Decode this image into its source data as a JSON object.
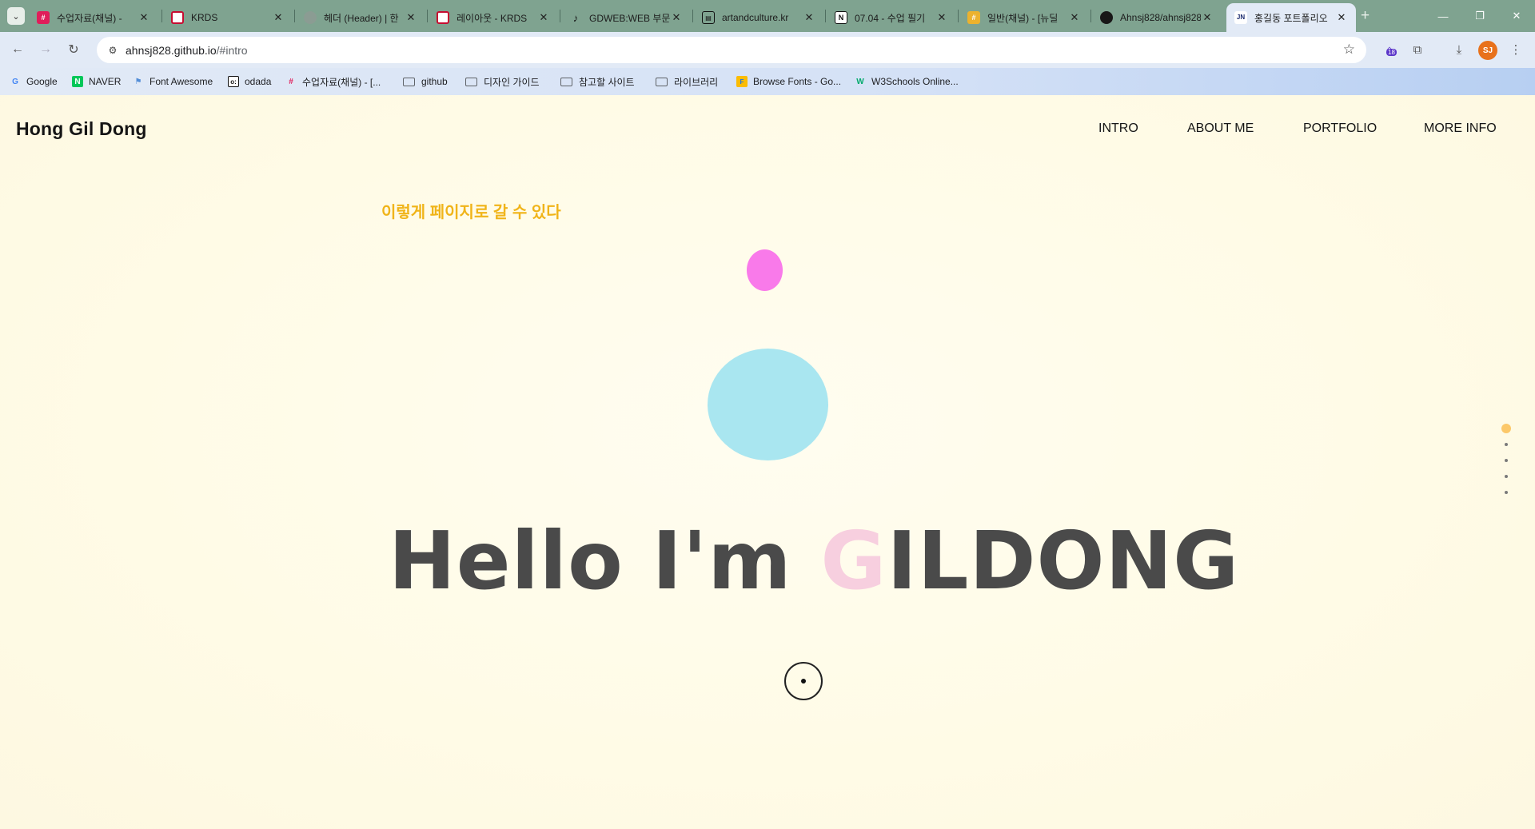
{
  "browser": {
    "tabs": [
      {
        "title": "수업자료(채널) -",
        "icon": "slack-icon"
      },
      {
        "title": "KRDS",
        "icon": "krds-icon"
      },
      {
        "title": "헤더 (Header) | 한",
        "icon": "globe-icon"
      },
      {
        "title": "레이아웃 - KRDS",
        "icon": "krds-icon"
      },
      {
        "title": "GDWEB:WEB 부문",
        "icon": "tiktok-icon"
      },
      {
        "title": "artandculture.kr",
        "icon": "artandculture-icon"
      },
      {
        "title": "07.04 - 수업 필기",
        "icon": "notion-icon"
      },
      {
        "title": "일반(채널) - [뉴딜",
        "icon": "slack-icon"
      },
      {
        "title": "Ahnsj828/ahnsj828",
        "icon": "github-icon"
      },
      {
        "title": "홍길동 포트폴리오",
        "icon": "portfolio-icon",
        "active": true
      }
    ],
    "url_host": "ahnsj828.github.io",
    "url_path": "/#intro",
    "extension_badge": "18",
    "profile_initials": "SJ",
    "bookmarks": [
      {
        "label": "Google",
        "icon": "google-icon"
      },
      {
        "label": "NAVER",
        "icon": "naver-icon"
      },
      {
        "label": "Font Awesome",
        "icon": "font-awesome-icon"
      },
      {
        "label": "odada",
        "icon": "odada-icon"
      },
      {
        "label": "수업자료(채널) - [...",
        "icon": "slack-icon"
      },
      {
        "label": "github",
        "icon": "folder-icon"
      },
      {
        "label": "디자인 가이드",
        "icon": "folder-icon"
      },
      {
        "label": "참고할 사이트",
        "icon": "folder-icon"
      },
      {
        "label": "라이브러리",
        "icon": "folder-icon"
      },
      {
        "label": "Browse Fonts - Go...",
        "icon": "google-fonts-icon"
      },
      {
        "label": "W3Schools Online...",
        "icon": "w3schools-icon"
      }
    ]
  },
  "site": {
    "logo": "Hong Gil Dong",
    "nav": [
      "INTRO",
      "ABOUT ME",
      "PORTFOLIO",
      "MORE INFO"
    ],
    "note": "이렇게 페이지로 갈 수 있다",
    "hero_prefix": "Hello I'm ",
    "hero_highlight": "G",
    "hero_suffix": "ILDONG",
    "section_dots": 5,
    "active_dot": 0,
    "colors": {
      "background": "#fffbe6",
      "accent_yellow": "#f0b419",
      "pink_blob": "#f97aea",
      "blue_blob": "#a9e6f0",
      "hero_text": "#4a4a4a",
      "hero_highlight": "#f7cfdf"
    }
  }
}
